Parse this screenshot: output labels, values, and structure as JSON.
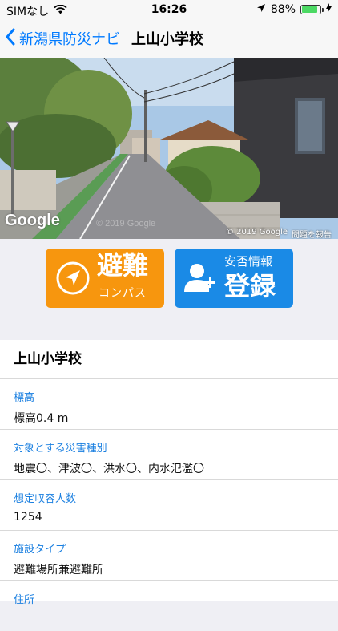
{
  "status": {
    "carrier": "SIMなし",
    "time": "16:26",
    "battery": "88%",
    "battery_level": 0.88
  },
  "nav": {
    "back_label": "新潟県防災ナビ",
    "title": "上山小学校"
  },
  "photo": {
    "google_logo": "Google",
    "watermark": "© 2019 Google",
    "copyright": "© 2019 Google",
    "report_link": "問題を報告"
  },
  "actions": {
    "evac": {
      "main": "避難",
      "sub": "コンパス"
    },
    "safety": {
      "top": "安否情報",
      "main": "登録"
    }
  },
  "facility": {
    "name": "上山小学校",
    "fields": [
      {
        "label": "標高",
        "value": "標高0.4 m"
      },
      {
        "label": "対象とする災害種別",
        "value": "地震〇、津波〇、洪水〇、内水氾濫〇"
      },
      {
        "label": "想定収容人数",
        "value": "1254"
      },
      {
        "label": "施設タイプ",
        "value": "避難場所兼避難所"
      },
      {
        "label": "住所",
        "value": ""
      }
    ]
  },
  "colors": {
    "accent": "#007aff",
    "orange": "#f7960e",
    "blue": "#1a8ae6",
    "label_blue": "#1a7fe0"
  }
}
